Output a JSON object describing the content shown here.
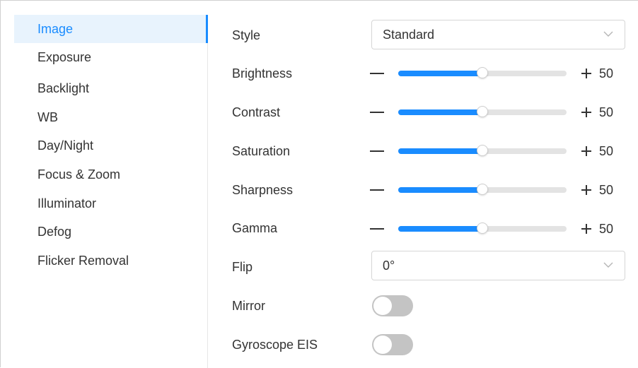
{
  "sidebar": {
    "items": [
      {
        "label": "Image",
        "active": true
      },
      {
        "label": "Exposure",
        "active": false
      },
      {
        "label": "Backlight",
        "active": false
      },
      {
        "label": "WB",
        "active": false
      },
      {
        "label": "Day/Night",
        "active": false
      },
      {
        "label": "Focus & Zoom",
        "active": false
      },
      {
        "label": "Illuminator",
        "active": false
      },
      {
        "label": "Defog",
        "active": false
      },
      {
        "label": "Flicker Removal",
        "active": false
      }
    ]
  },
  "form": {
    "style": {
      "label": "Style",
      "value": "Standard"
    },
    "brightness": {
      "label": "Brightness",
      "value": 50,
      "min": 0,
      "max": 100
    },
    "contrast": {
      "label": "Contrast",
      "value": 50,
      "min": 0,
      "max": 100
    },
    "saturation": {
      "label": "Saturation",
      "value": 50,
      "min": 0,
      "max": 100
    },
    "sharpness": {
      "label": "Sharpness",
      "value": 50,
      "min": 0,
      "max": 100
    },
    "gamma": {
      "label": "Gamma",
      "value": 50,
      "min": 0,
      "max": 100
    },
    "flip": {
      "label": "Flip",
      "value": "0°"
    },
    "mirror": {
      "label": "Mirror",
      "on": false
    },
    "gyroscope_eis": {
      "label": "Gyroscope EIS",
      "on": false
    }
  },
  "colors": {
    "accent": "#1a8cff",
    "active_bg": "#e8f3fd",
    "toggle_off": "#c4c4c4",
    "track": "#e3e3e3"
  },
  "icons": {
    "dropdown": "chevron-down-icon",
    "decrease": "minus-icon",
    "increase": "plus-icon"
  }
}
